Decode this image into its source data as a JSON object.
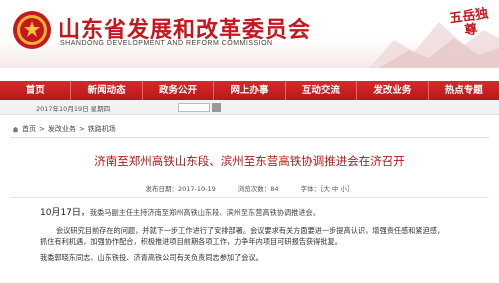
{
  "header": {
    "title": "山东省发展和改革委员会",
    "subtitle": "SHANDONG DEVELOPMENT AND REFORM COMMISSION",
    "stamp_text": "五岳独尊",
    "brand_color": "#c8161d"
  },
  "nav": {
    "items": [
      {
        "label": "首页"
      },
      {
        "label": "新闻动态"
      },
      {
        "label": "政务公开"
      },
      {
        "label": "网上办事"
      },
      {
        "label": "互动交流"
      },
      {
        "label": "发改业务"
      },
      {
        "label": "热点专题"
      }
    ]
  },
  "date_bar": {
    "date": "2017年10月19日 星期四"
  },
  "breadcrumb": {
    "items": [
      "首页",
      "发改业务",
      "铁路机场"
    ],
    "separator": " > "
  },
  "article": {
    "title": "济南至郑州高铁山东段、滨州至东营高铁协调推进会在济召开",
    "meta": {
      "published": "发布日期：2017-10-19",
      "views": "浏览次数：84",
      "font_size": "字体：［大 中 小］"
    },
    "p1_lead": "10月17日，",
    "p1_rest": "我委马副主任主持济南至郑州高铁山东段、滨州至东营高铁协调推进会。",
    "p2_line1": "会议研究目前存在的问题，并就下一步工作进行了安排部署。会议要求有关方面要进一步提高认识，增强责任感和紧迫感，",
    "p2_line2": "抓住有利机遇，加强协作配合，积极推进项目前期各项工作，力争年内项目可研报告获得批复。",
    "p3": "我委郭晓东同志、山东铁投、济青高铁公司有关负责同志参加了会议。"
  }
}
